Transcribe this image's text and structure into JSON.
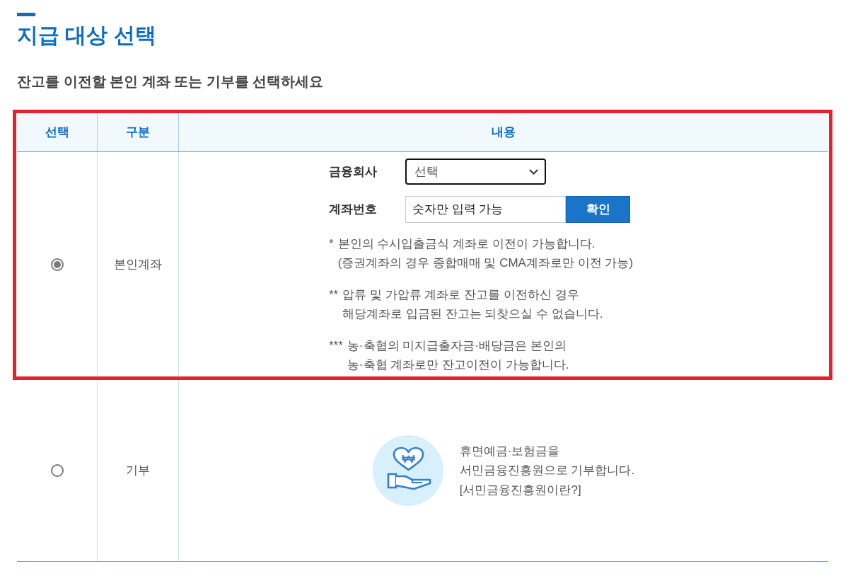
{
  "section": {
    "title": "지급 대상 선택",
    "subtitle": "잔고를 이전할 본인 계좌 또는 기부를 선택하세요"
  },
  "table": {
    "columns": [
      "선택",
      "구분",
      "내용"
    ],
    "rows": [
      {
        "kind": "account",
        "selected": true,
        "highlighted": true,
        "category": "본인계좌",
        "fields": [
          {
            "kind": "select",
            "label": "금융회사",
            "value": "선택"
          },
          {
            "kind": "input",
            "label": "계좌번호",
            "placeholder": "숫자만 입력 가능",
            "button": "확인"
          }
        ],
        "notes": [
          {
            "mark": "*",
            "text": "본인의 수시입출금식 계좌로 이전이 가능합니다.\n(증권계좌의 경우 종합매매 및 CMA계좌로만 이전 가능)"
          },
          {
            "mark": "**",
            "text": "압류 및 가압류 계좌로 잔고를 이전하신 경우\n해당계좌로 입금된 잔고는 되찾으실 수 없습니다."
          },
          {
            "mark": "***",
            "text": "농·축협의 미지급출자금·배당금은 본인의\n농·축협 계좌로만 잔고이전이 가능합니다."
          }
        ]
      },
      {
        "kind": "donation",
        "selected": false,
        "highlighted": false,
        "category": "기부",
        "text": "휴면예금·보험금을\n서민금융진흥원으로 기부합니다.",
        "link": "[서민금융진흥원이란?]"
      }
    ]
  }
}
